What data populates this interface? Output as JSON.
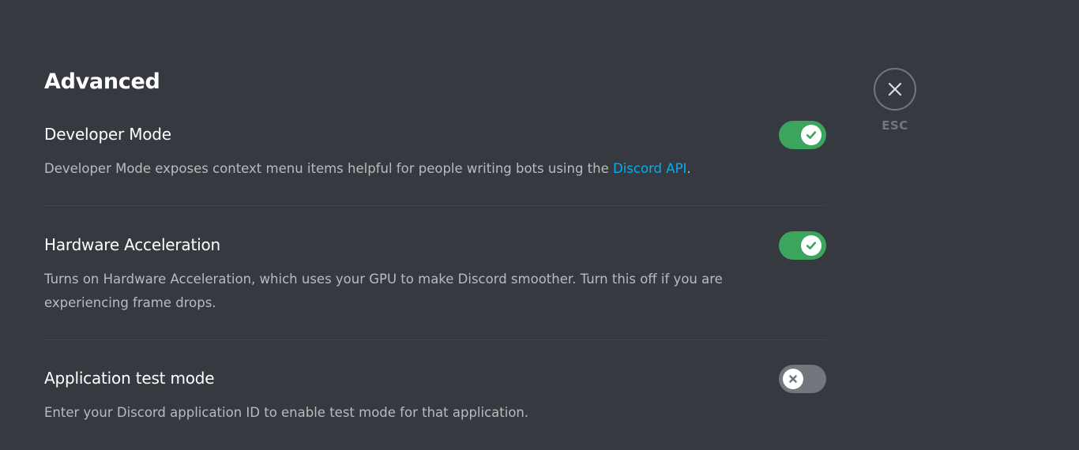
{
  "page": {
    "title": "Advanced"
  },
  "close": {
    "label": "ESC"
  },
  "settings": [
    {
      "title": "Developer Mode",
      "desc_before_link": "Developer Mode exposes context menu items helpful for people writing bots using the ",
      "link_text": "Discord API",
      "desc_after_link": ".",
      "enabled": true
    },
    {
      "title": "Hardware Acceleration",
      "desc": "Turns on Hardware Acceleration, which uses your GPU to make Discord smoother. Turn this off if you are experiencing frame drops.",
      "enabled": true
    },
    {
      "title": "Application test mode",
      "desc": "Enter your Discord application ID to enable test mode for that application.",
      "enabled": false
    }
  ],
  "colors": {
    "background": "#36393f",
    "toggle_on": "#3ba55d",
    "toggle_off": "#72767d",
    "link": "#00aff4"
  }
}
